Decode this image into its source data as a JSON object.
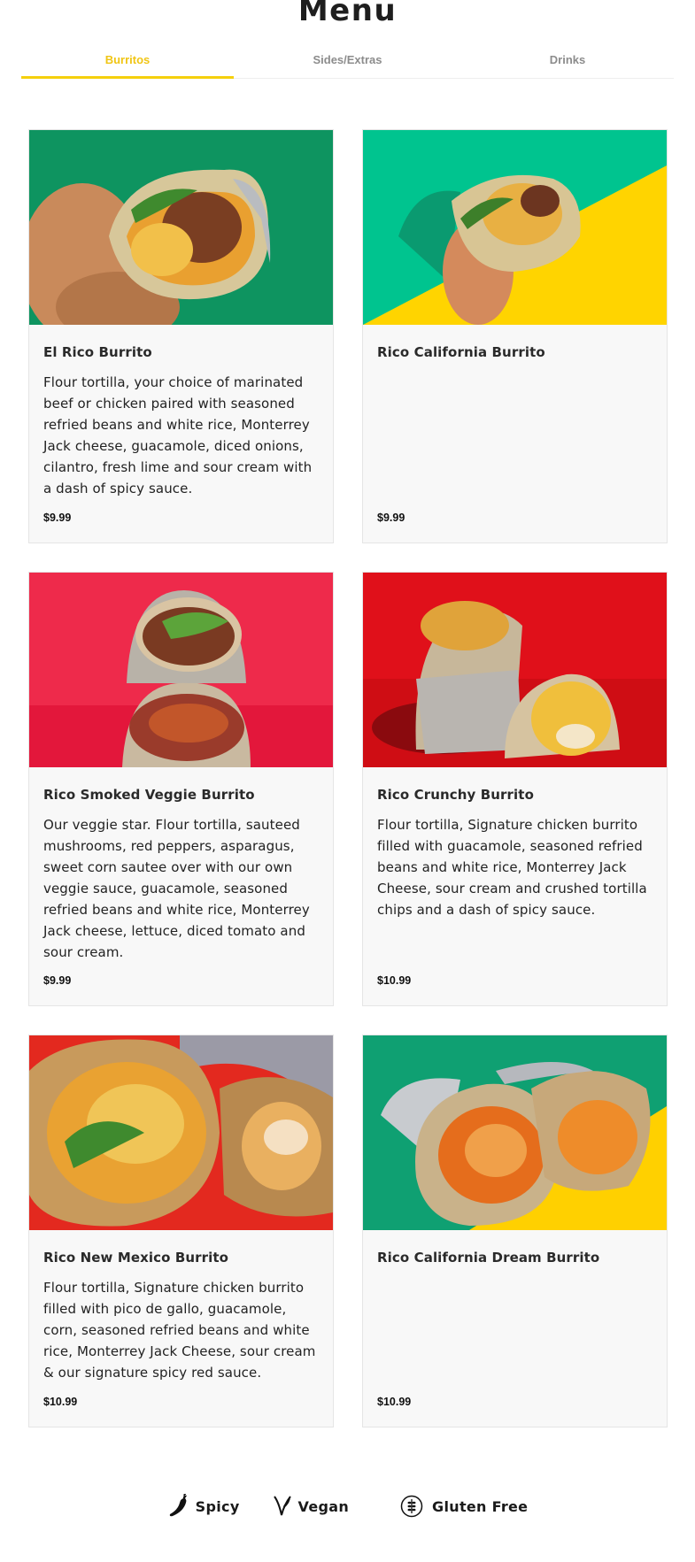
{
  "page": {
    "title": "Menu"
  },
  "tabs": [
    {
      "label": "Burritos",
      "active": true
    },
    {
      "label": "Sides/Extras",
      "active": false
    },
    {
      "label": "Drinks",
      "active": false
    }
  ],
  "items": [
    {
      "name": "El Rico Burrito",
      "description": "Flour tortilla, your choice of marinated beef or chicken paired with seasoned refried beans and white rice, Monterrey Jack cheese, guacamole, diced onions, cilantro, fresh lime and sour cream with a dash of spicy sauce.",
      "price": "$9.99",
      "image": "burrito-photo-green-background"
    },
    {
      "name": "Rico California Burrito",
      "description": "",
      "price": "$9.99",
      "image": "burrito-photo-green-yellow-background"
    },
    {
      "name": "Rico Smoked Veggie Burrito",
      "description": "Our veggie star. Flour tortilla, sauteed mushrooms, red peppers, asparagus, sweet corn sautee over with our own veggie sauce, guacamole, seasoned refried beans and white rice, Monterrey Jack cheese, lettuce, diced tomato and sour cream.",
      "price": "$9.99",
      "image": "burrito-photo-pink-background"
    },
    {
      "name": "Rico Crunchy Burrito",
      "description": "Flour tortilla, Signature chicken burrito filled with guacamole, seasoned refried beans and white rice, Monterrey Jack Cheese, sour cream and crushed tortilla chips and a dash of spicy sauce.",
      "price": "$10.99",
      "image": "burrito-photo-red-background"
    },
    {
      "name": "Rico New Mexico Burrito",
      "description": "Flour tortilla, Signature chicken burrito filled with pico de gallo, guacamole, corn, seasoned refried beans and white rice, Monterrey Jack Cheese, sour cream & our signature spicy red sauce.",
      "price": "$10.99",
      "image": "burrito-photo-red-orange-background"
    },
    {
      "name": "Rico California Dream Burrito",
      "description": "",
      "price": "$10.99",
      "image": "burrito-photo-green-yellow-background"
    }
  ],
  "legend": [
    {
      "label": "Spicy",
      "icon": "chili-pepper-icon"
    },
    {
      "label": "Vegan",
      "icon": "vegan-leaf-icon"
    },
    {
      "label": "Gluten Free",
      "icon": "gluten-free-icon"
    }
  ],
  "colors": {
    "accent": "#f5d00c",
    "card_bg": "#f8f8f8",
    "tab_inactive": "#8c8c8c"
  }
}
